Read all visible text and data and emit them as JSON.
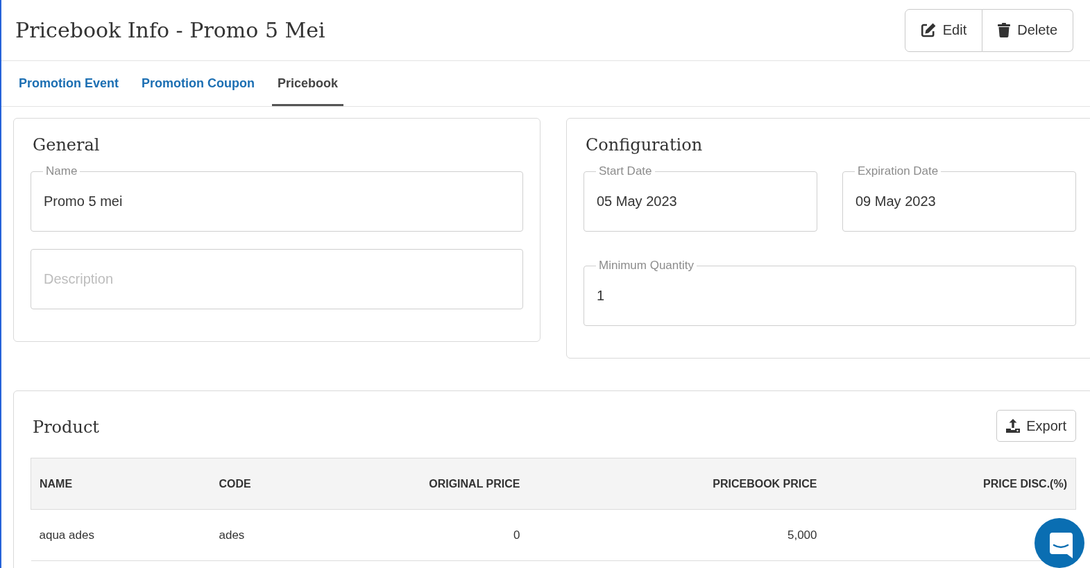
{
  "header": {
    "title": "Pricebook Info - Promo 5 Mei",
    "actions": [
      {
        "kind": "edit",
        "label": "Edit"
      },
      {
        "kind": "delete",
        "label": "Delete"
      }
    ]
  },
  "tabs": [
    {
      "label": "Promotion Event",
      "selected": false
    },
    {
      "label": "Promotion Coupon",
      "selected": false
    },
    {
      "label": "Pricebook",
      "selected": true
    }
  ],
  "general": {
    "title": "General",
    "fields": [
      {
        "label": "Name",
        "value": "Promo 5 mei"
      },
      {
        "placeholder": "Description"
      }
    ]
  },
  "configuration": {
    "title": "Configuration",
    "rows": [
      [
        {
          "label": "Start Date",
          "value": "05 May 2023"
        },
        {
          "label": "Expiration Date",
          "value": "09 May 2023"
        }
      ],
      [
        {
          "label": "Minimum Quantity",
          "value": "1"
        }
      ]
    ]
  },
  "product": {
    "title": "Product",
    "export_button": "Export",
    "table": {
      "columns": [
        {
          "label": "NAME",
          "kind": "text"
        },
        {
          "label": "CODE",
          "kind": "text"
        },
        {
          "label": "ORIGINAL PRICE",
          "kind": "number"
        },
        {
          "label": "PRICEBOOK PRICE",
          "kind": "number"
        },
        {
          "label": "PRICE DISC.(%)",
          "kind": "number"
        }
      ],
      "rows": [
        [
          "aqua ades",
          "ades",
          "0",
          "5,000"
        ]
      ]
    }
  }
}
